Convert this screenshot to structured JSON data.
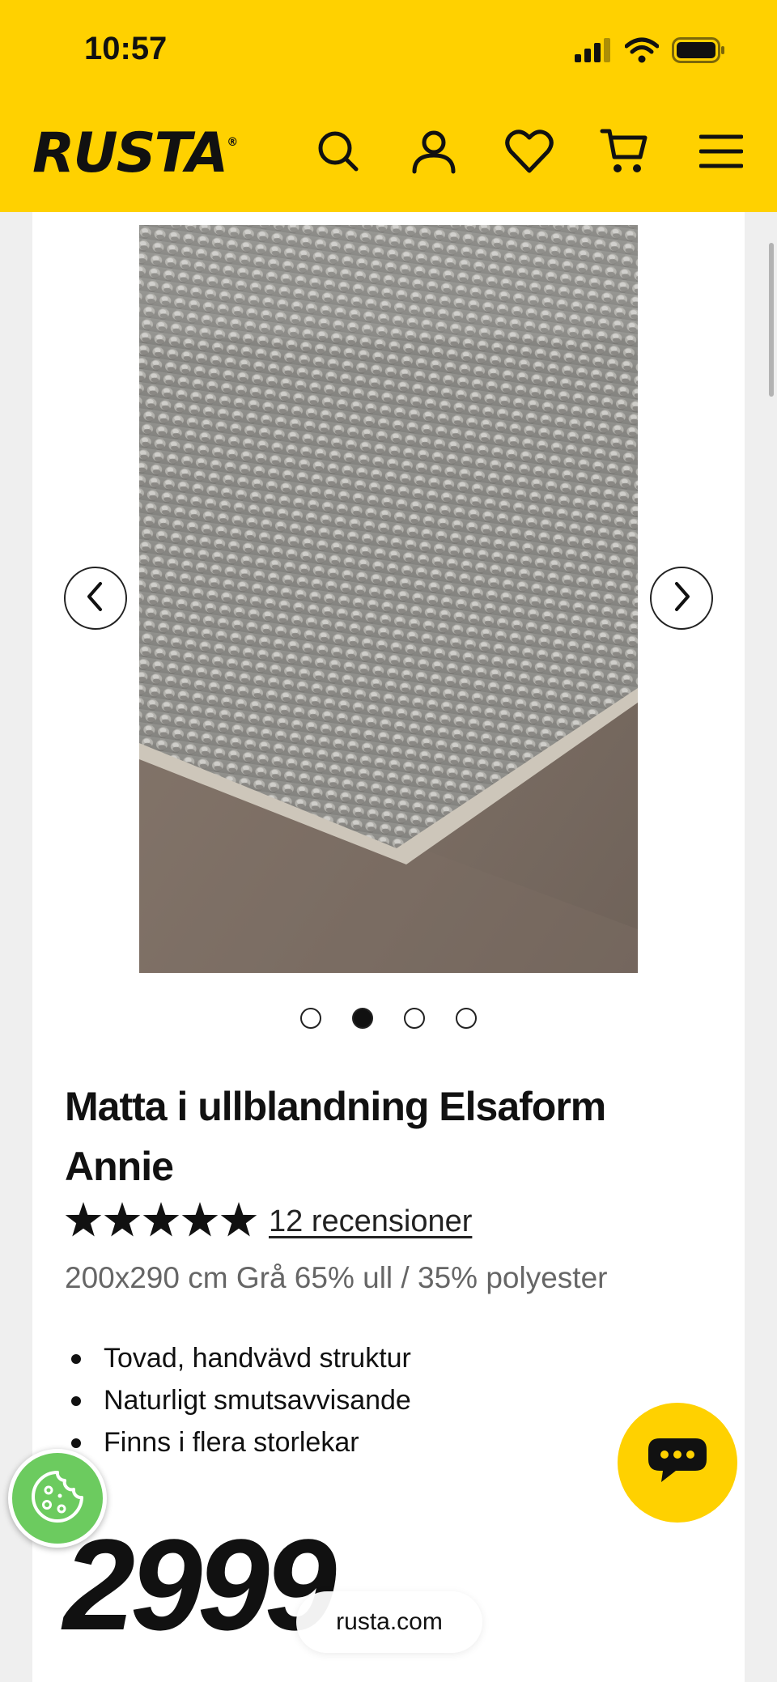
{
  "status_bar": {
    "time": "10:57"
  },
  "header": {
    "logo": "RUSTA",
    "logo_mark": "®",
    "icons": [
      "search-icon",
      "account-icon",
      "heart-icon",
      "cart-icon",
      "menu-icon"
    ],
    "background": "#ffd100"
  },
  "gallery": {
    "image_count": 4,
    "active_index": 1,
    "image_alt": "Grå ullmatta närbild"
  },
  "product": {
    "title": "Matta i ullblandning Elsaform Annie",
    "stars": "★★★★★",
    "rating": 5,
    "reviews": "12 recensioner",
    "variant": "200x290 cm Grå 65% ull / 35% polyester",
    "bullets": [
      "Tovad, handvävd struktur",
      "Naturligt smutsavvisande",
      "Finns i flera storlekar"
    ],
    "price": "2999"
  },
  "browser": {
    "url": "rusta.com"
  },
  "colors": {
    "brand_yellow": "#ffd100",
    "cookie_green": "#6ccb5f",
    "text": "#111111",
    "muted": "#666666"
  }
}
